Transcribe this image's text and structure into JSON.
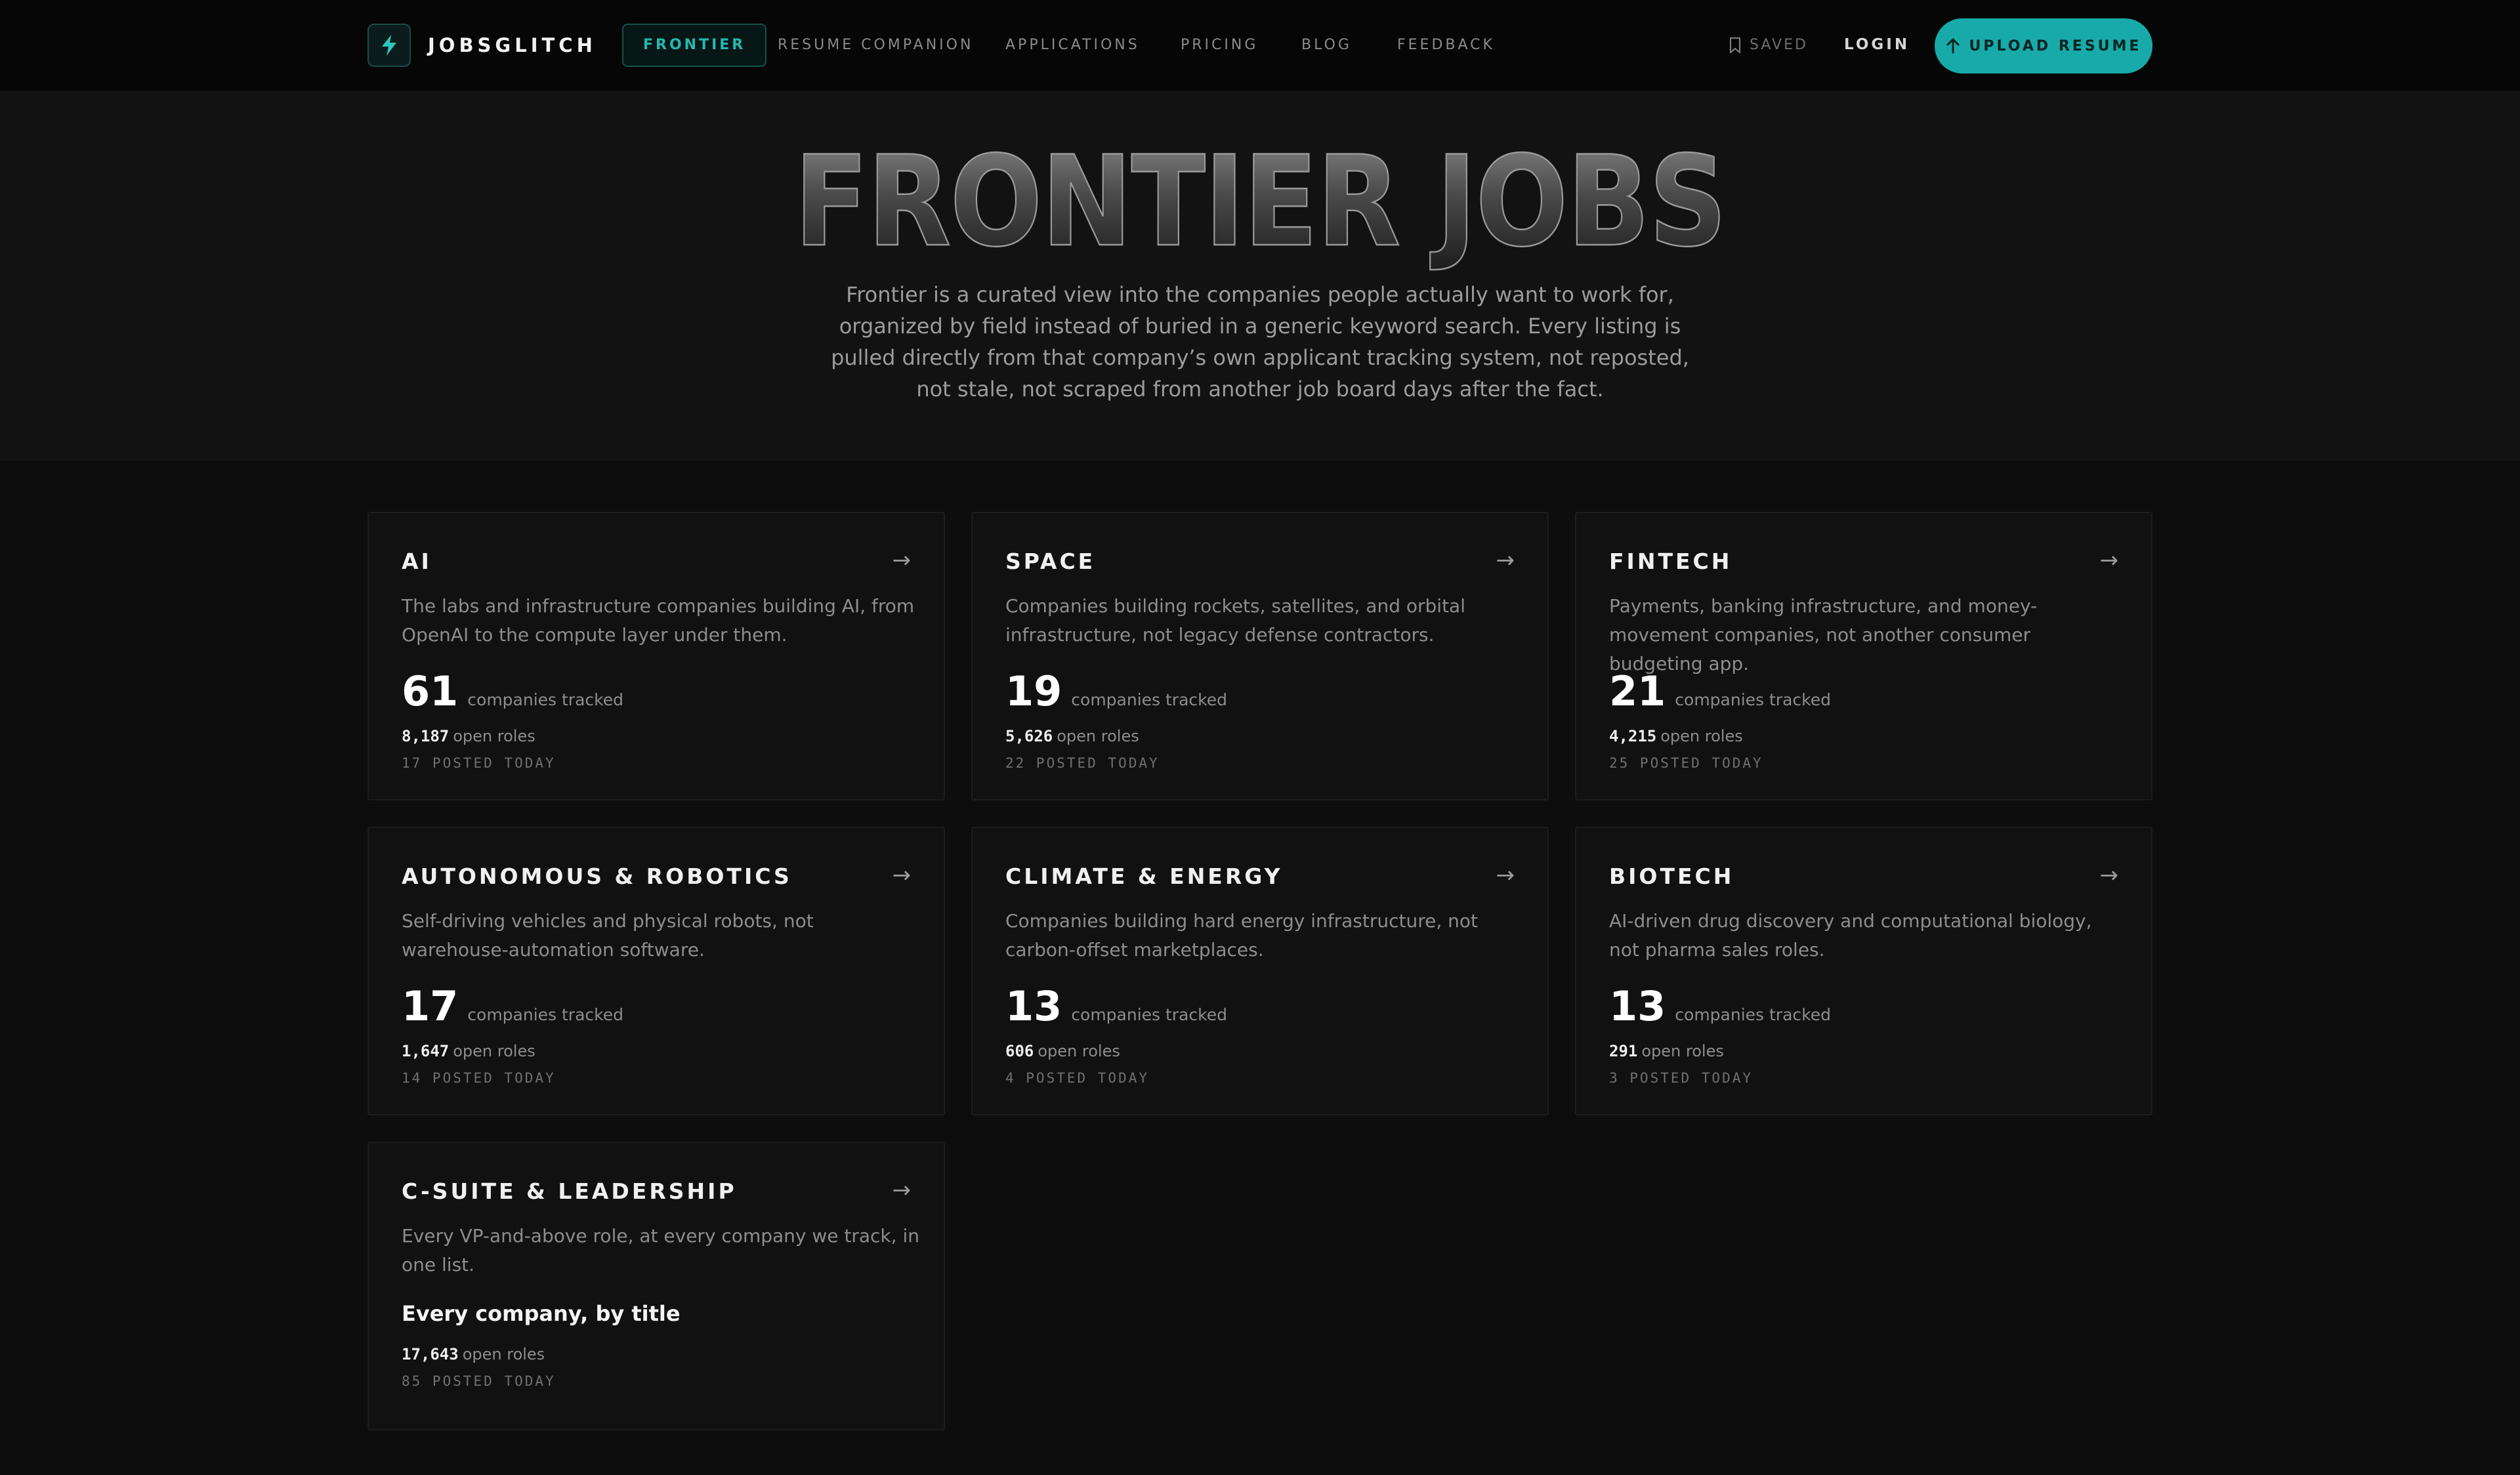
{
  "nav": {
    "brand": "JOBSGLITCH",
    "links": [
      "FRONTIER",
      "RESUME COMPANION",
      "APPLICATIONS",
      "PRICING",
      "BLOG",
      "FEEDBACK"
    ],
    "active": "FRONTIER",
    "saved": "SAVED",
    "login": "LOGIN",
    "upload": "UPLOAD RESUME"
  },
  "hero": {
    "title": "FRONTIER JOBS",
    "description": "Frontier is a curated view into the companies people actually want to work for, organized by field instead of buried in a generic keyword search. Every listing is pulled directly from that company’s own applicant tracking system, not reposted, not stale, not scraped from another job board days after the fact."
  },
  "cards": [
    {
      "title": "AI",
      "desc": "The labs and infrastructure companies building AI, from OpenAI to the compute layer under them.",
      "count": "61",
      "count_label": "companies tracked",
      "roles": "8,187",
      "roles_label": "open roles",
      "today": "17 POSTED TODAY",
      "arrow": "→"
    },
    {
      "title": "SPACE",
      "desc": "Companies building rockets, satellites, and orbital infrastructure, not legacy defense contractors.",
      "count": "19",
      "count_label": "companies tracked",
      "roles": "5,626",
      "roles_label": "open roles",
      "today": "22 POSTED TODAY",
      "arrow": "→"
    },
    {
      "title": "FINTECH",
      "desc": "Payments, banking infrastructure, and money-movement companies, not another consumer budgeting app.",
      "count": "21",
      "count_label": "companies tracked",
      "roles": "4,215",
      "roles_label": "open roles",
      "today": "25 POSTED TODAY",
      "arrow": "→"
    },
    {
      "title": "AUTONOMOUS & ROBOTICS",
      "desc": "Self-driving vehicles and physical robots, not warehouse-automation software.",
      "count": "17",
      "count_label": "companies tracked",
      "roles": "1,647",
      "roles_label": "open roles",
      "today": "14 POSTED TODAY",
      "arrow": "→"
    },
    {
      "title": "CLIMATE & ENERGY",
      "desc": "Companies building hard energy infrastructure, not carbon-offset marketplaces.",
      "count": "13",
      "count_label": "companies tracked",
      "roles": "606",
      "roles_label": "open roles",
      "today": "4 POSTED TODAY",
      "arrow": "→"
    },
    {
      "title": "BIOTECH",
      "desc": "AI-driven drug discovery and computational biology, not pharma sales roles.",
      "count": "13",
      "count_label": "companies tracked",
      "roles": "291",
      "roles_label": "open roles",
      "today": "3 POSTED TODAY",
      "arrow": "→"
    },
    {
      "title": "C-SUITE & LEADERSHIP",
      "desc": "Every VP-and-above role, at every company we track, in one list.",
      "subtitle": "Every company, by title",
      "roles": "17,643",
      "roles_label": "open roles",
      "today": "85 POSTED TODAY",
      "arrow": "→"
    }
  ],
  "colors": {
    "accent": "#17aaa8",
    "background": "#0d0d0d",
    "card": "#111111"
  }
}
